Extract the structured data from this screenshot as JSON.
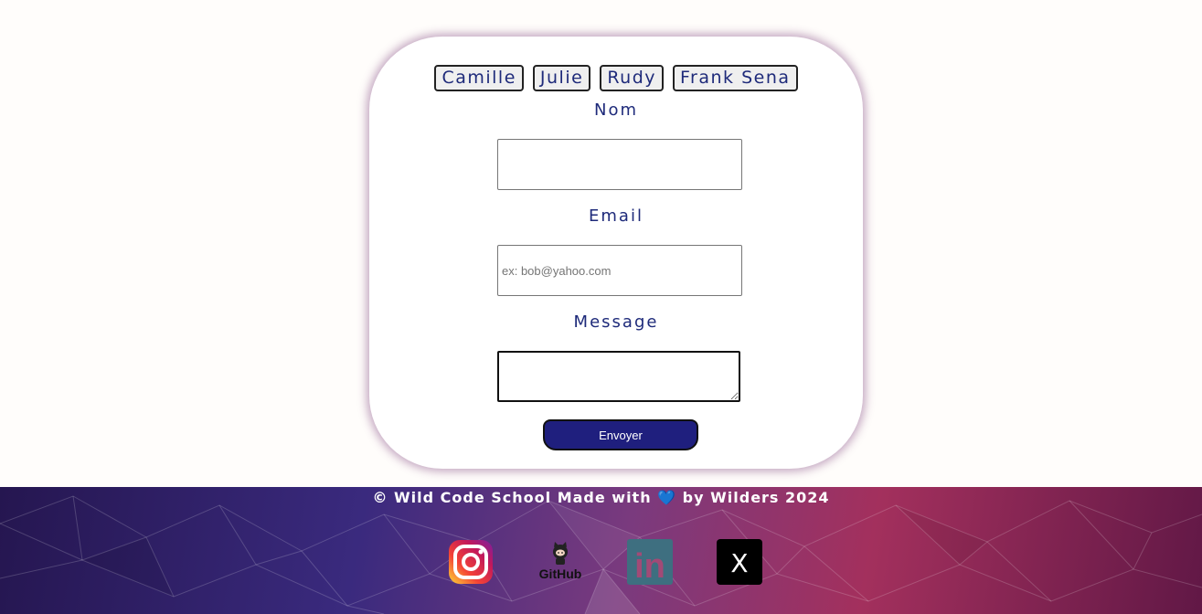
{
  "tabs": [
    "Camille",
    "Julie",
    "Rudy",
    "Frank Sena"
  ],
  "form": {
    "nom_label": "Nom",
    "nom_value": "",
    "email_label": "Email",
    "email_placeholder": "ex: bob@yahoo.com",
    "message_label": "Message",
    "message_value": "",
    "submit_label": "Envoyer"
  },
  "footer": {
    "text_before": "© Wild Code School Made with ",
    "heart": "💙",
    "text_after": " by Wilders 2024",
    "github_label": "GitHub",
    "linkedin_label": "in",
    "x_label": "X"
  },
  "colors": {
    "accent": "#1e2a7a",
    "button_bg": "#1f1f7e",
    "page_bg": "#fffdfb"
  },
  "icons": [
    "instagram-icon",
    "github-icon",
    "linkedin-icon",
    "x-icon"
  ]
}
